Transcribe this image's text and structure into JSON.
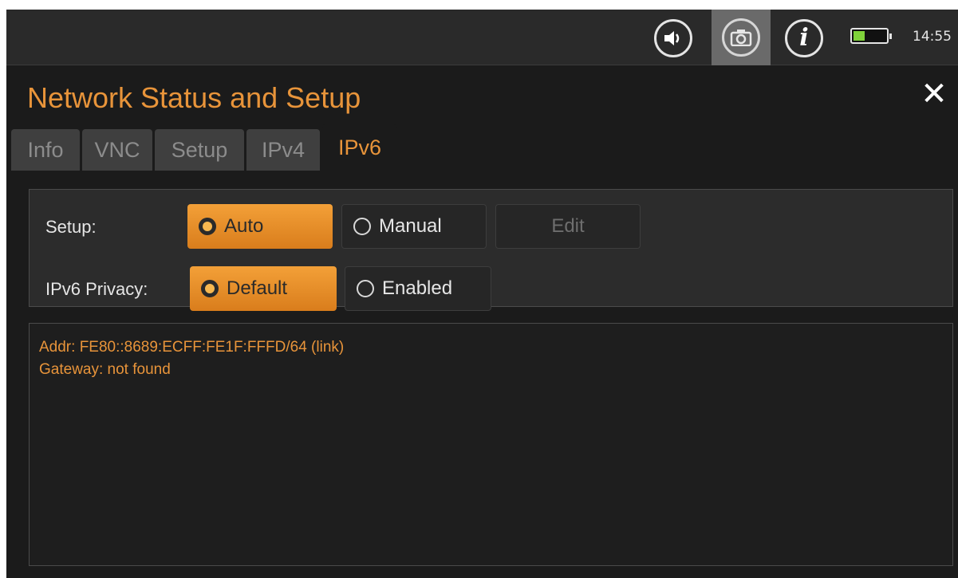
{
  "statusbar": {
    "speaker_icon": "speaker-icon",
    "camera_icon": "camera-icon",
    "info_icon": "info-icon",
    "info_glyph": "i",
    "battery_level": 0.35,
    "battery_color": "#7fd23a",
    "time": "14:55"
  },
  "header": {
    "title": "Network Status and Setup",
    "close_glyph": "✕"
  },
  "tabs": [
    {
      "label": "Info",
      "active": false
    },
    {
      "label": "VNC",
      "active": false
    },
    {
      "label": "Setup",
      "active": false
    },
    {
      "label": "IPv4",
      "active": false
    },
    {
      "label": "IPv6",
      "active": true
    }
  ],
  "setup": {
    "label": "Setup:",
    "options": [
      {
        "label": "Auto",
        "selected": true
      },
      {
        "label": "Manual",
        "selected": false
      }
    ],
    "edit_label": "Edit",
    "edit_enabled": false
  },
  "privacy": {
    "label": "IPv6 Privacy:",
    "options": [
      {
        "label": "Default",
        "selected": true
      },
      {
        "label": "Enabled",
        "selected": false
      }
    ]
  },
  "output": {
    "lines": [
      "Addr: FE80::8689:ECFF:FE1F:FFFD/64 (link)",
      "Gateway: not found"
    ]
  },
  "colors": {
    "accent": "#e8943a",
    "selected_button": "#f09a35",
    "background": "#1b1b1b"
  }
}
